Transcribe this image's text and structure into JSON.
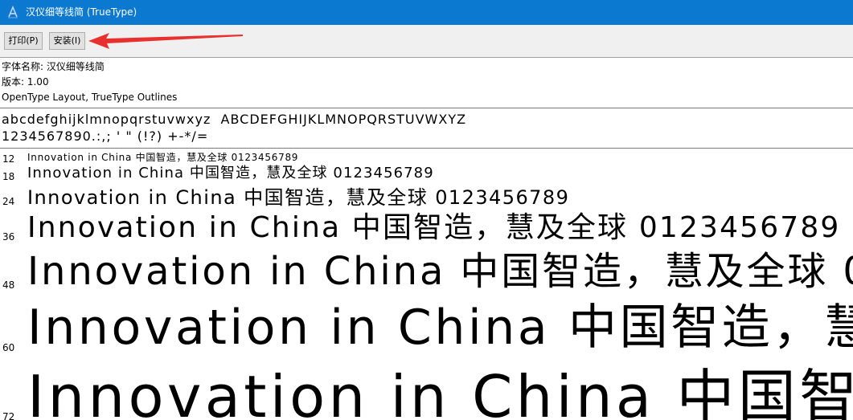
{
  "window": {
    "title": "汉仪细等线简 (TrueType)",
    "titlebar_color": "#0b79d0",
    "app_icon": "font-file-icon"
  },
  "toolbar": {
    "print_label": "打印(P)",
    "install_label": "安装(I)",
    "annotation": "red-arrow-pointing-at-install"
  },
  "font_info": {
    "name_line": "字体名称: 汉仪细等线简",
    "version_line": "版本: 1.00",
    "outline_line": "OpenType Layout, TrueType Outlines"
  },
  "glyph_preview": {
    "line1": "abcdefghijklmnopqrstuvwxyz  ABCDEFGHIJKLMNOPQRSTUVWXYZ",
    "line2": "1234567890.:,; ' \" (!?) +-*/="
  },
  "samples": {
    "text": "Innovation  in  China  中国智造，慧及全球  0123456789",
    "rows": [
      {
        "size": "12"
      },
      {
        "size": "18"
      },
      {
        "size": "24"
      },
      {
        "size": "36"
      },
      {
        "size": "48"
      },
      {
        "size": "60"
      },
      {
        "size": "72"
      }
    ]
  }
}
